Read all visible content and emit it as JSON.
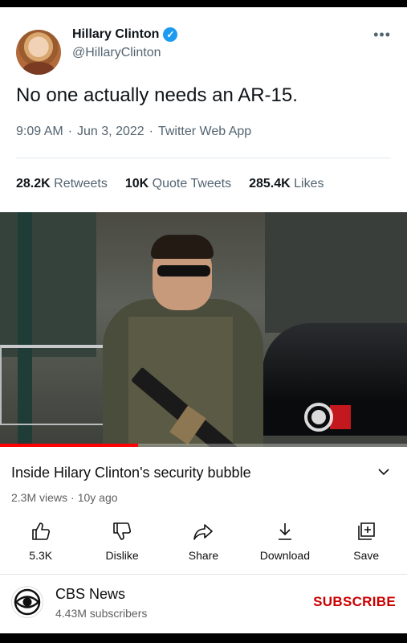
{
  "tweet": {
    "author_name": "Hillary Clinton",
    "verified_icon": "verified-check-icon",
    "handle": "@HillaryClinton",
    "more_icon": "more-options-icon",
    "text": "No one actually needs an AR-15.",
    "time": "9:09 AM",
    "date": "Jun 3, 2022",
    "source": "Twitter Web App",
    "separator": "·",
    "stats": [
      {
        "value": "28.2K",
        "label": "Retweets"
      },
      {
        "value": "10K",
        "label": "Quote Tweets"
      },
      {
        "value": "285.4K",
        "label": "Likes"
      }
    ],
    "accent_color": "#1d9bf0"
  },
  "video": {
    "progress_fraction": 0.34,
    "progress_color": "#ff0000"
  },
  "youtube": {
    "title": "Inside Hilary Clinton's security bubble",
    "views": "2.3M views",
    "separator": "·",
    "age": "10y ago",
    "actions": [
      {
        "icon": "thumbs-up-icon",
        "label": "5.3K"
      },
      {
        "icon": "thumbs-down-icon",
        "label": "Dislike"
      },
      {
        "icon": "share-icon",
        "label": "Share"
      },
      {
        "icon": "download-icon",
        "label": "Download"
      },
      {
        "icon": "save-playlist-icon",
        "label": "Save"
      }
    ],
    "channel": {
      "logo_icon": "cbs-eye-logo",
      "name": "CBS News",
      "subscribers": "4.43M subscribers"
    },
    "subscribe_label": "SUBSCRIBE",
    "subscribe_color": "#cc0000"
  }
}
